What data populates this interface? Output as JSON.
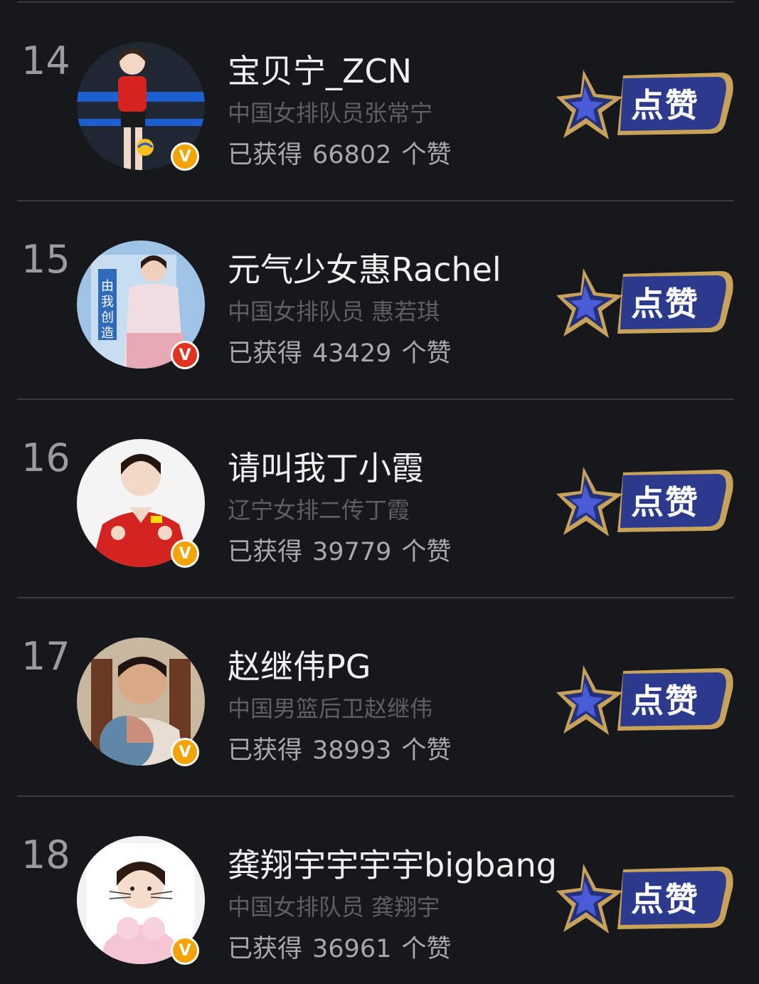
{
  "button_label": "点赞",
  "likes_prefix": "已获得",
  "likes_suffix": "个赞",
  "colors": {
    "background": "#17181b",
    "badge_gold": "#f5a300",
    "badge_red": "#e0321e",
    "button_blue": "#2b3a8c",
    "button_gold": "#c9a25a"
  },
  "entries": [
    {
      "rank": "14",
      "name": "宝贝宁_ZCN",
      "description": "中国女排队员张常宁",
      "likes": "66802",
      "badge": "gold",
      "badge_label": "V"
    },
    {
      "rank": "15",
      "name": "元气少女惠Rachel",
      "description": "中国女排队员 惠若琪",
      "likes": "43429",
      "badge": "red",
      "badge_label": "V"
    },
    {
      "rank": "16",
      "name": "请叫我丁小霞",
      "description": "辽宁女排二传丁霞",
      "likes": "39779",
      "badge": "gold",
      "badge_label": "V"
    },
    {
      "rank": "17",
      "name": "赵继伟PG",
      "description": "中国男篮后卫赵继伟",
      "likes": "38993",
      "badge": "gold",
      "badge_label": "V"
    },
    {
      "rank": "18",
      "name": "龚翔宇宇宇宇bigbang",
      "description": "中国女排队员 龚翔宇",
      "likes": "36961",
      "badge": "gold",
      "badge_label": "V"
    }
  ]
}
